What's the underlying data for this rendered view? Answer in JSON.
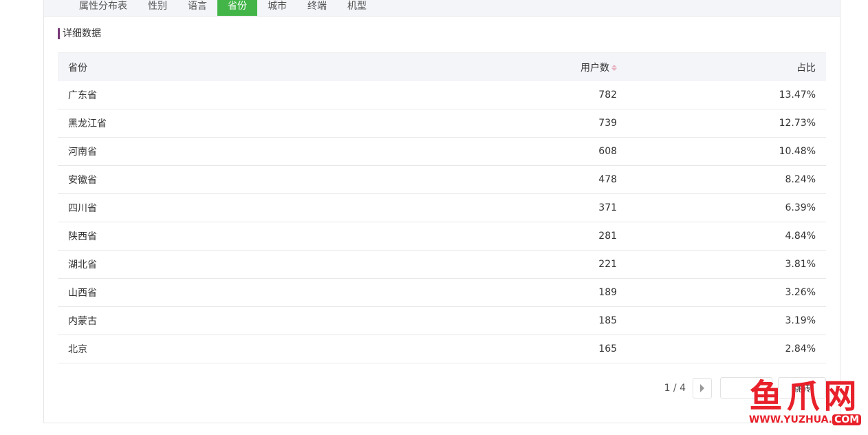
{
  "tabs": [
    {
      "label": "属性分布表"
    },
    {
      "label": "性别"
    },
    {
      "label": "语言"
    },
    {
      "label": "省份",
      "active": true
    },
    {
      "label": "城市"
    },
    {
      "label": "终端"
    },
    {
      "label": "机型"
    }
  ],
  "section_title": "详细数据",
  "table": {
    "headers": [
      "省份",
      "用户数",
      "占比"
    ],
    "rows": [
      [
        "广东省",
        "782",
        "13.47%"
      ],
      [
        "黑龙江省",
        "739",
        "12.73%"
      ],
      [
        "河南省",
        "608",
        "10.48%"
      ],
      [
        "安徽省",
        "478",
        "8.24%"
      ],
      [
        "四川省",
        "371",
        "6.39%"
      ],
      [
        "陕西省",
        "281",
        "4.84%"
      ],
      [
        "湖北省",
        "221",
        "3.81%"
      ],
      [
        "山西省",
        "189",
        "3.26%"
      ],
      [
        "内蒙古",
        "185",
        "3.19%"
      ],
      [
        "北京",
        "165",
        "2.84%"
      ]
    ]
  },
  "pagination": {
    "info": "1 / 4",
    "go_label": "跳转",
    "page_input": ""
  },
  "watermark": {
    "text": "鱼爪网",
    "url": "WWW.YUZHUA.",
    "tld": "COM"
  },
  "colors": {
    "active_tab": "#43b548",
    "title_bar": "#7a3a7a",
    "watermark": "#e8202a"
  }
}
